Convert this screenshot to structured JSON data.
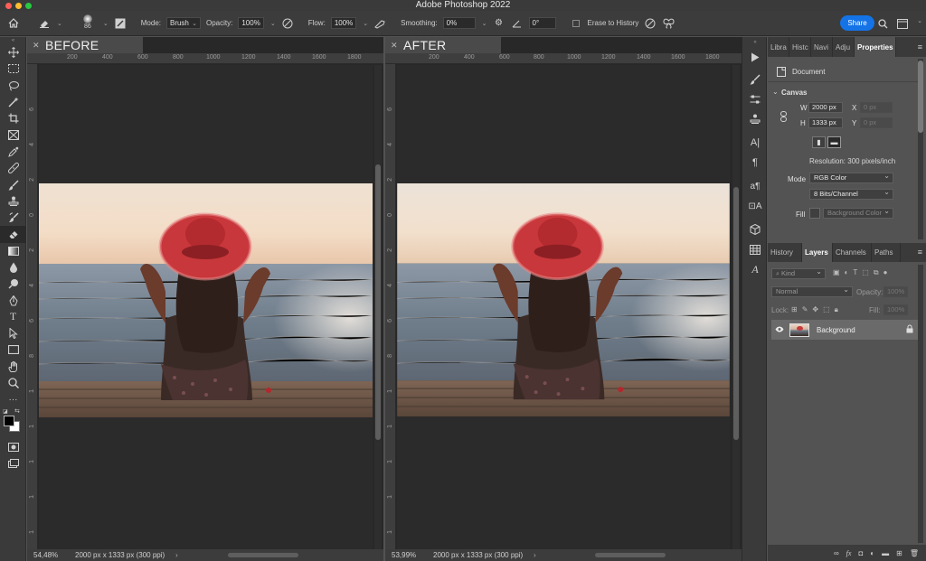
{
  "app": {
    "title": "Adobe Photoshop 2022"
  },
  "options": {
    "brush_size": "86",
    "mode_label": "Mode:",
    "mode_value": "Brush",
    "opacity_label": "Opacity:",
    "opacity_value": "100%",
    "flow_label": "Flow:",
    "flow_value": "100%",
    "smoothing_label": "Smoothing:",
    "smoothing_value": "0%",
    "angle_value": "0°",
    "erase_history_label": "Erase to History",
    "share_label": "Share"
  },
  "documents": [
    {
      "tab_label": "BEFORE",
      "ruler_h": [
        "200",
        "400",
        "600",
        "800",
        "1000",
        "1200",
        "1400",
        "1600",
        "1800"
      ],
      "ruler_v": [
        "6",
        "4",
        "2",
        "0",
        "2",
        "4",
        "6",
        "8",
        "1",
        "1",
        "1",
        "1",
        "1",
        "1"
      ],
      "zoom": "54,48%",
      "doc_info": "2000 px x 1333 px (300 ppi)"
    },
    {
      "tab_label": "AFTER",
      "ruler_h": [
        "200",
        "400",
        "600",
        "800",
        "1000",
        "1200",
        "1400",
        "1600",
        "1800"
      ],
      "ruler_v": [
        "6",
        "4",
        "2",
        "0",
        "2",
        "4",
        "6",
        "8",
        "1",
        "1",
        "1",
        "1",
        "1",
        "1"
      ],
      "zoom": "53,99%",
      "doc_info": "2000 px x 1333 px (300 ppi)"
    }
  ],
  "properties": {
    "tabs": [
      "Libra",
      "Histc",
      "Navi",
      "Adju",
      "Properties"
    ],
    "active_tab": "Properties",
    "kind_label": "Document",
    "section_title": "Canvas",
    "width_label": "W",
    "width_value": "2000 px",
    "height_label": "H",
    "height_value": "1333 px",
    "x_label": "X",
    "x_value": "0 px",
    "y_label": "Y",
    "y_value": "0 px",
    "resolution": "Resolution: 300 pixels/inch",
    "mode_label": "Mode",
    "mode_value": "RGB Color",
    "depth_value": "8 Bits/Channel",
    "fill_label": "Fill",
    "fill_value": "Background Color"
  },
  "layers": {
    "tabs": [
      "History",
      "Layers",
      "Channels",
      "Paths"
    ],
    "active_tab": "Layers",
    "filter_label": "Kind",
    "blend_mode": "Normal",
    "opacity_label": "Opacity:",
    "opacity_value": "100%",
    "lock_label": "Lock:",
    "fill_label": "Fill:",
    "fill_value": "100%",
    "items": [
      {
        "name": "Background"
      }
    ]
  },
  "colors": {
    "accent": "#1473e6",
    "hat_red": "#c8373b"
  }
}
